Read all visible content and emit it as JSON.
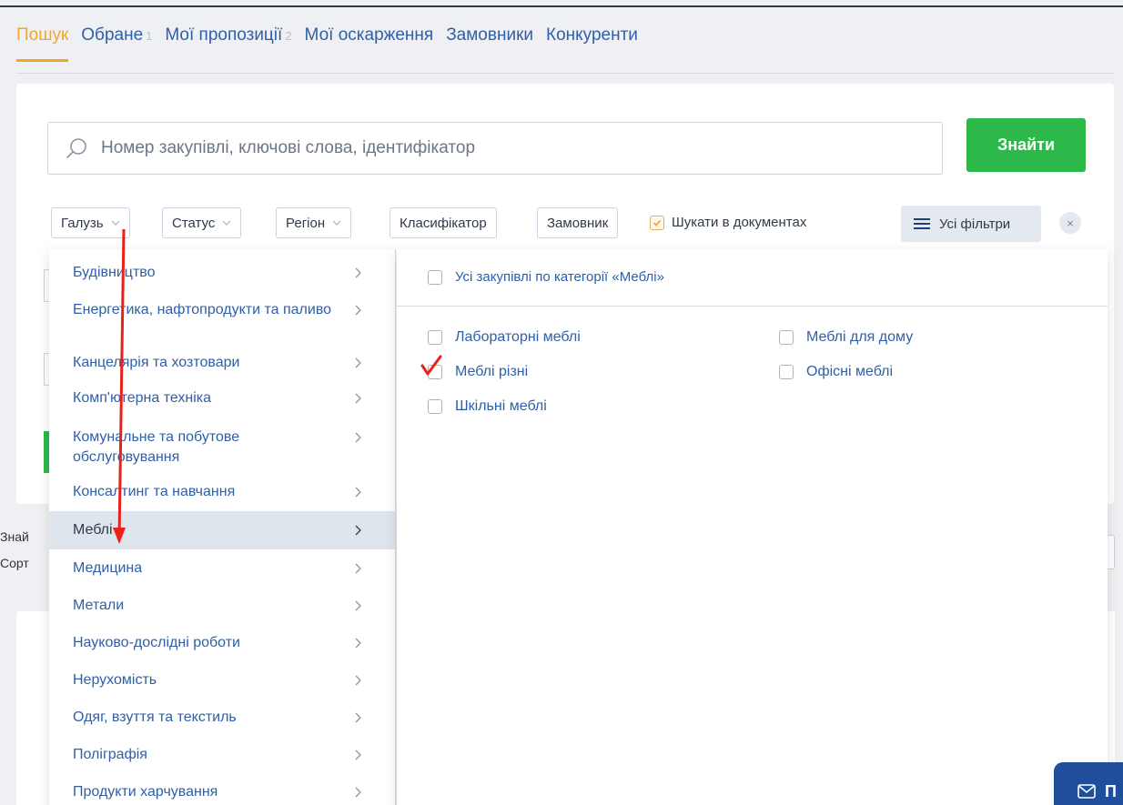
{
  "tabs": [
    {
      "label": "Пошук",
      "count": ""
    },
    {
      "label": "Обране",
      "count": "1"
    },
    {
      "label": "Мої пропозиції",
      "count": "2"
    },
    {
      "label": "Мої оскарження",
      "count": ""
    },
    {
      "label": "Замовники",
      "count": ""
    },
    {
      "label": "Конкуренти",
      "count": ""
    }
  ],
  "search": {
    "placeholder": "Номер закупівлі, ключові слова, ідентифікатор",
    "button_label": "Знайти"
  },
  "filters": {
    "industry": "Галузь",
    "status": "Статус",
    "region": "Регіон",
    "classifier": "Класифікатор",
    "customer": "Замовник",
    "search_in_docs": "Шукати в документах",
    "all_filters": "Усі фільтри",
    "clear": "×"
  },
  "background_fragments": {
    "found": "Знай",
    "sort": "Сорт"
  },
  "categories": [
    "Будівництво",
    "Енергетика, нафтопродукти та паливо",
    "Канцелярія та хозтовари",
    "Комп'ютерна техніка",
    "Комунальне та побутове обслуговування",
    "Консалтинг та навчання",
    "Меблі",
    "Медицина",
    "Метали",
    "Науково-дослідні роботи",
    "Нерухомість",
    "Одяг, взуття та текстиль",
    "Поліграфія",
    "Продукти харчування"
  ],
  "subcategories": {
    "all_label": "Усі закупівлі по категорії «Меблі»",
    "left": [
      "Лабораторні меблі",
      "Меблі різні",
      "Шкільні меблі"
    ],
    "right": [
      "Меблі для дому",
      "Офісні меблі"
    ]
  },
  "chat_widget": {
    "label": "П"
  },
  "colors": {
    "accent_orange": "#f5a623",
    "link_blue": "#2f5fa8",
    "green_button": "#2db84a",
    "annotation_red": "#e8221b"
  }
}
